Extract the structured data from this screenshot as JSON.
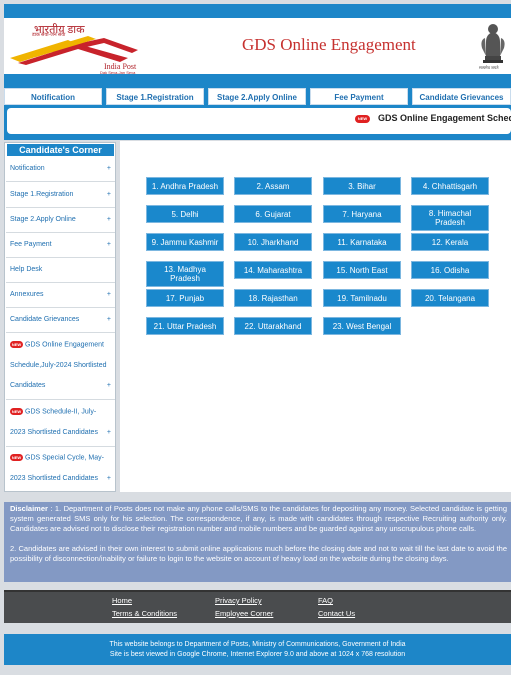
{
  "header": {
    "logo_hindi": "भारतीय डाक",
    "logo_sub": "डाक सेवा-जन सेवा",
    "logo_name": "India Post",
    "logo_tag": "Dak Seva-Jan Seva",
    "title": "GDS Online Engagement",
    "emblem_text": "सत्यमेव जयते"
  },
  "nav": [
    "Notification",
    "Stage 1.Registration",
    "Stage 2.Apply Online",
    "Fee Payment",
    "Candidate Grievances"
  ],
  "ticker": {
    "new_label": "NEW",
    "text": "GDS Online Engagement Schedule"
  },
  "sidebar": {
    "title": "Candidate's Corner",
    "items": [
      {
        "label": "Notification",
        "plus": "+"
      },
      {
        "label": "Stage 1.Registration",
        "plus": "+"
      },
      {
        "label": "Stage 2.Apply Online",
        "plus": "+"
      },
      {
        "label": "Fee Payment",
        "plus": "+"
      },
      {
        "label": "Help Desk",
        "plus": ""
      },
      {
        "label": "Annexures",
        "plus": "+"
      },
      {
        "label": "Candidate Grievances",
        "plus": "+"
      }
    ],
    "news": [
      {
        "line1": "GDS Online Engagement",
        "line2": "Schedule,July-2024 Shortlisted",
        "line3": "Candidates",
        "plus": "+"
      },
      {
        "line1": "GDS Schedule-II, July-",
        "line2": "2023 Shortlisted Candidates",
        "plus": "+"
      },
      {
        "line1": "GDS Special Cycle, May-",
        "line2": "2023 Shortlisted Candidates",
        "plus": "+"
      }
    ],
    "new_label": "NEW"
  },
  "states": [
    "1. Andhra Pradesh",
    "2. Assam",
    "3. Bihar",
    "4. Chhattisgarh",
    "5. Delhi",
    "6. Gujarat",
    "7. Haryana",
    "8. Himachal Pradesh",
    "9. Jammu Kashmir",
    "10. Jharkhand",
    "11. Karnataka",
    "12. Kerala",
    "13. Madhya Pradesh",
    "14. Maharashtra",
    "15. North East",
    "16. Odisha",
    "17. Punjab",
    "18. Rajasthan",
    "19. Tamilnadu",
    "20. Telangana",
    "21. Uttar Pradesh",
    "22. Uttarakhand",
    "23. West Bengal"
  ],
  "disclaimer": {
    "label": "Disclaimer",
    "p1": " : 1. Department of Posts does not make any phone calls/SMS to the candidates for depositing any money. Selected candidate is getting system generated SMS only for his selection. The correspondence, if any, is made with candidates through respective Recruiting authority only. Candidates are advised not to disclose their registration number and mobile numbers and be guarded against any unscrupulous phone calls.",
    "p2": "2. Candidates are advised in their own interest to submit online applications much before the closing date and not to wait till the last date to avoid the possibility of disconnection/inability or failure to login to the website on account of heavy load on the website during the closing days."
  },
  "footer": {
    "home": "Home",
    "privacy": "Privacy Policy",
    "faq": "FAQ",
    "terms": "Terms & Conditions",
    "employee": "Employee Corner",
    "contact": "Contact Us"
  },
  "bottom": {
    "line1": "This website belongs to Department of Posts, Ministry of Communications, Government of India",
    "line2": "Site is best viewed in Google Chrome, Internet Explorer 9.0 and above at 1024 x 768 resolution"
  },
  "colors": {
    "primary": "#1d86c8",
    "title_red": "#c6312f",
    "new_badge": "#e02121",
    "disclaimer_bg": "#8399c4",
    "footer_bg": "#4a4c4e"
  }
}
